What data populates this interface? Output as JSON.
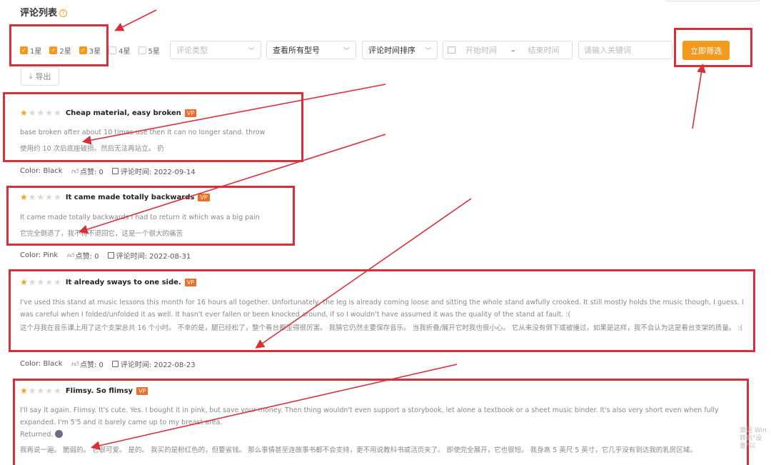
{
  "page": {
    "title": "评论列表",
    "help_icon": "question-circle-icon"
  },
  "filters": {
    "stars": [
      {
        "label": "1星",
        "checked": true
      },
      {
        "label": "2星",
        "checked": true
      },
      {
        "label": "3星",
        "checked": true
      },
      {
        "label": "4星",
        "checked": false
      },
      {
        "label": "5星",
        "checked": false
      }
    ],
    "review_type": {
      "placeholder": "评论类型"
    },
    "model": {
      "value": "查看所有型号"
    },
    "sort": {
      "value": "评论时间排序"
    },
    "date_range": {
      "start_placeholder": "开始时间",
      "separator": "–",
      "end_placeholder": "结束时间"
    },
    "keyword": {
      "placeholder": "请输入关键词"
    },
    "filter_button": "立即筛选",
    "export_button": "导出"
  },
  "reviews": [
    {
      "rating": 1,
      "title": "Cheap material, easy broken",
      "badge": "VP",
      "body_en": "base broken after about 10 times use then it can no longer stand. throw",
      "body_zh": "使用约 10 次后底座破损。然后无法再站立。 扔",
      "color": "Color: Black",
      "likes": "点赞: 0",
      "time": "评论时间: 2022-09-14"
    },
    {
      "rating": 1,
      "title": "It came made totally backwards",
      "badge": "VP",
      "body_en": "It came made totally backwards I had to return it which was a big pain",
      "body_zh": "它完全倒退了，我不得不退回它，这是一个很大的痛苦",
      "color": "Color: Pink",
      "likes": "点赞: 0",
      "time": "评论时间: 2022-08-31"
    },
    {
      "rating": 1,
      "title": "It already sways to one side.",
      "badge": "VP",
      "body_en": "I've used this stand at music lessons this month for 16 hours all together. Unfortunately, the leg is already coming loose and sitting the whole stand awfully crooked. It still mostly holds the music though, I guess. I was careful when I folded/unfolded it as well. It hasn't ever fallen or been knocked around, if so I wouldn't have assumed it was the quality of the stand at fault. :(",
      "body_zh": "这个月我在音乐课上用了这个支架总共 16 个小时。 不幸的是，腿已经松了，整个看台都歪得很厉害。 我猜它仍然主要保存音乐。 当我折叠/展开它时我也很小心。 它从来没有倒下或被撞过，如果是这样，我不会认为这是看台支架的质量。 :(",
      "color": "Color: Black",
      "likes": "点赞: 0",
      "time": "评论时间: 2022-08-23"
    },
    {
      "rating": 1,
      "title": "Flimsy. So flimsy",
      "badge": "VP",
      "body_en": "I'll say it again. Flimsy. It's cute. Yes. I bought it in pink, but save your money. Then thing wouldn't even support a storybook, let alone a textbook or a sheet music binder. It's also very short even when fully expanded. I'm 5'5 and it barely came up to my breast area.",
      "returned": "Returned.",
      "body_zh": "我再说一遍。 脆弱的。 它很可爱。 是的。 我买的是粉红色的，但要省钱。 那么事情甚至连故事书都不会支持，更不用说教科书或活页夹了。 即使完全展开，它也很短。 我身高 5 英尺 5 英寸，它几乎没有到达我的乳房区域。"
    }
  ],
  "watermark": {
    "line1": "激活 Win",
    "line2": "转到\"设置\"以"
  },
  "colors": {
    "accent": "#f39a1e",
    "annotation": "#d8303b",
    "vp_badge": "#ed6d2b"
  }
}
